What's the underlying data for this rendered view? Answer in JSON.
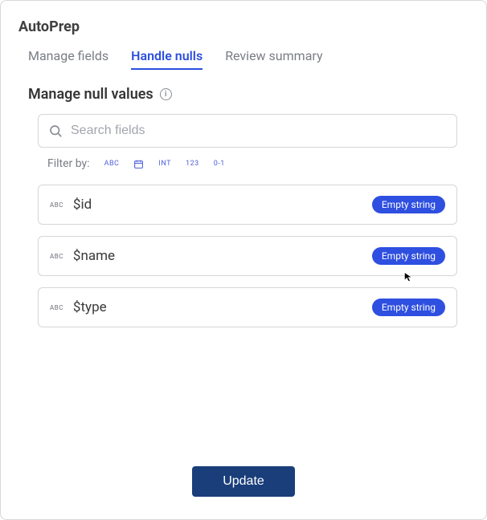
{
  "title": "AutoPrep",
  "tabs": [
    {
      "label": "Manage fields",
      "active": false
    },
    {
      "label": "Handle nulls",
      "active": true
    },
    {
      "label": "Review summary",
      "active": false
    }
  ],
  "section": {
    "heading": "Manage null values"
  },
  "search": {
    "placeholder": "Search fields",
    "value": ""
  },
  "filter": {
    "label": "Filter by:",
    "chips": [
      "ABC",
      "date",
      "INT",
      "123",
      "0-1"
    ]
  },
  "fields": [
    {
      "type": "ABC",
      "name": "$id",
      "null_handling": "Empty string"
    },
    {
      "type": "ABC",
      "name": "$name",
      "null_handling": "Empty string"
    },
    {
      "type": "ABC",
      "name": "$type",
      "null_handling": "Empty string"
    }
  ],
  "actions": {
    "update_label": "Update"
  }
}
